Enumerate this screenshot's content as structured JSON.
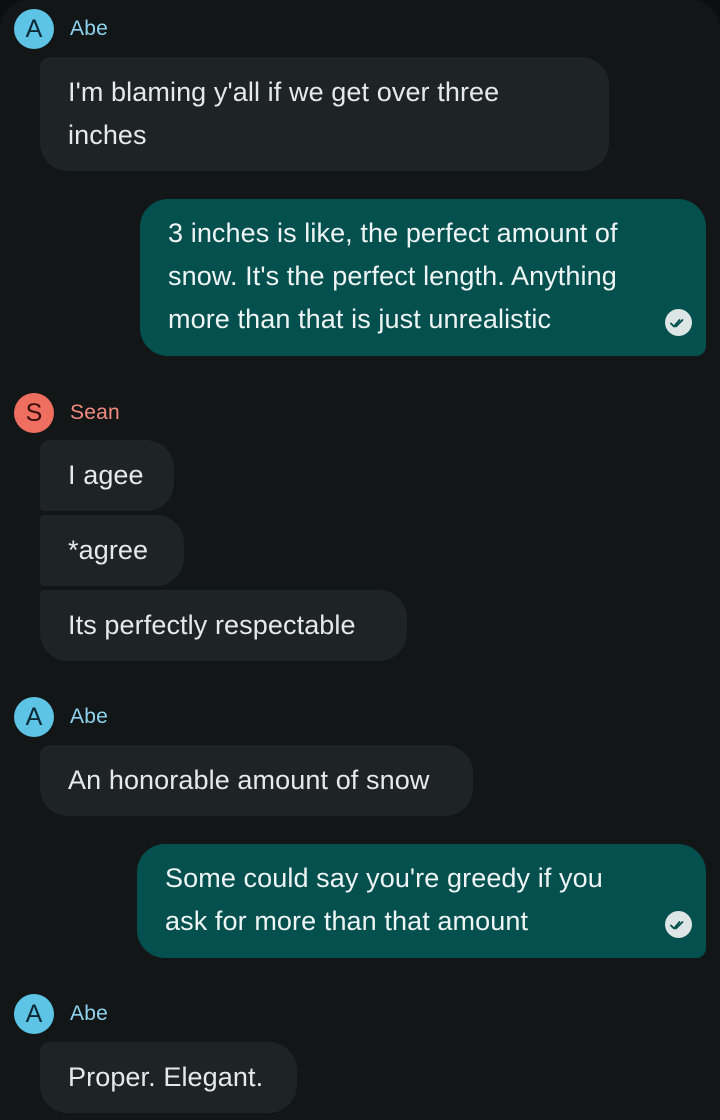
{
  "conversation": {
    "messages": [
      {
        "sender": "Abe",
        "initial": "A",
        "text": "I'm blaming y'all if we get over three inches"
      },
      {
        "sender": "me",
        "text": "3 inches is like, the perfect amount of snow. It's the perfect length. Anything more than that is just unrealistic",
        "status_icon": "read-check-icon"
      },
      {
        "sender": "Sean",
        "initial": "S",
        "text": "I agee"
      },
      {
        "sender": "Sean",
        "text": "*agree"
      },
      {
        "sender": "Sean",
        "text": "Its perfectly respectable"
      },
      {
        "sender": "Abe",
        "initial": "A",
        "text": "An honorable amount of snow"
      },
      {
        "sender": "me",
        "text": "Some could say you're greedy if you ask for more than that amount",
        "status_icon": "read-check-icon"
      },
      {
        "sender": "Abe",
        "initial": "A",
        "text": "Proper. Elegant."
      }
    ]
  },
  "colors": {
    "background": "#121617",
    "incoming_bubble": "#1e2325",
    "outgoing_bubble": "#04504e",
    "abe_avatar": "#5ec4e6",
    "sean_avatar": "#ee6e60"
  }
}
